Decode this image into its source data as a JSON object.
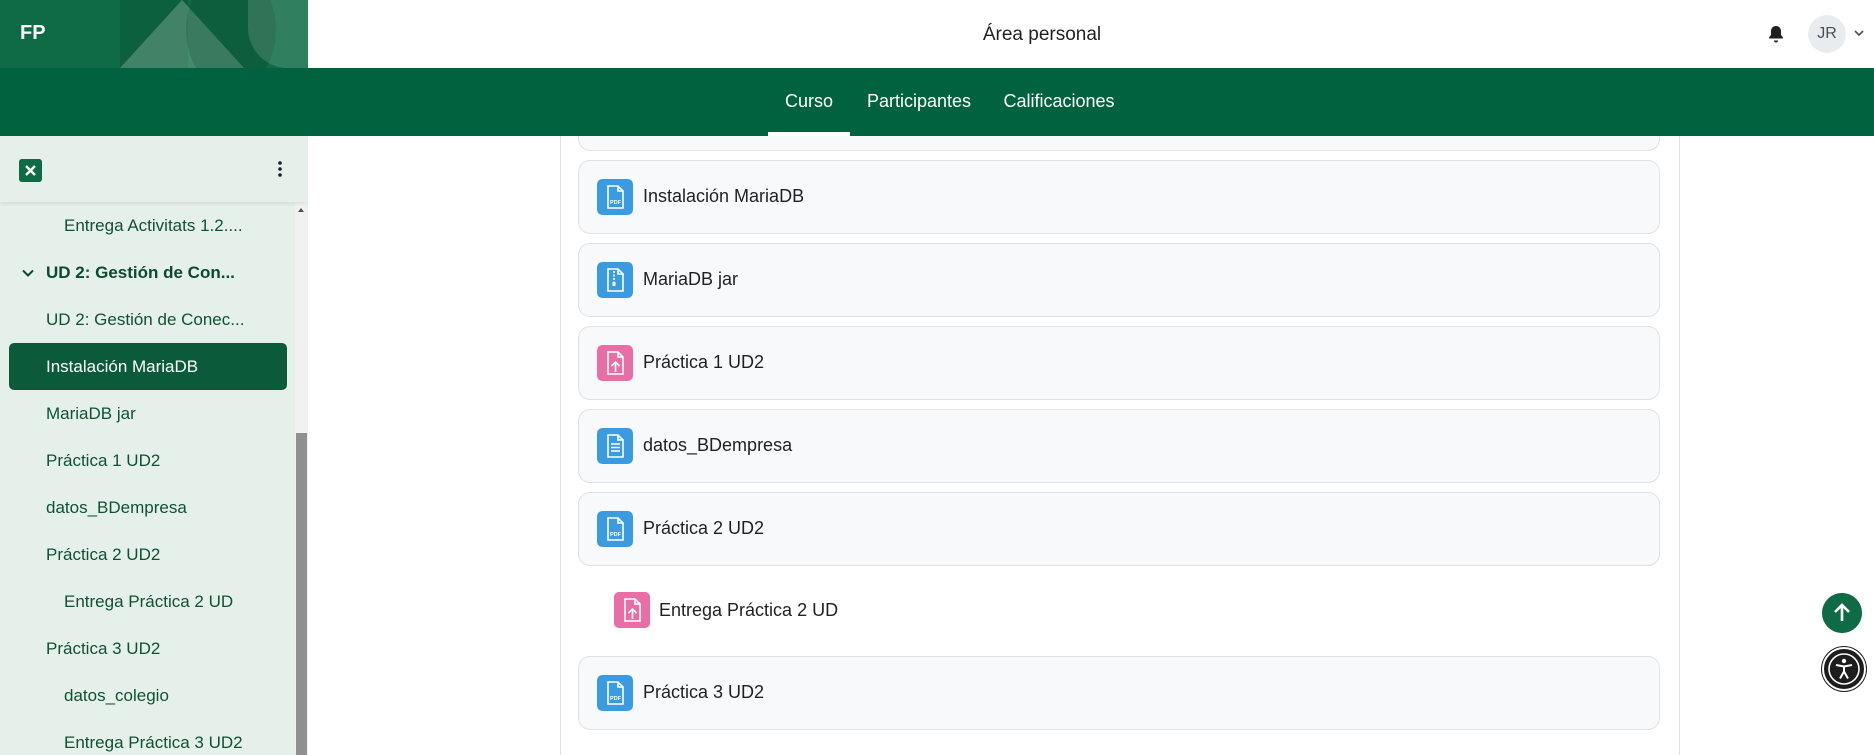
{
  "brand": {
    "text": "FP",
    "color": "#0f6b45"
  },
  "header": {
    "title": "Área personal",
    "bell_icon": "bell-icon",
    "avatar_initials": "JR",
    "avatar_menu_icon": "chevron-down-icon"
  },
  "nav": {
    "tabs": [
      {
        "label": "Curso",
        "active": true
      },
      {
        "label": "Participantes",
        "active": false
      },
      {
        "label": "Calificaciones",
        "active": false
      }
    ],
    "background": "#00623f"
  },
  "sidebar": {
    "close_icon": "close-icon",
    "menu_icon": "kebab-menu-icon",
    "items": [
      {
        "label": "Entrega Activitats 1.2....",
        "level": 2
      },
      {
        "label": "UD 2: Gestión de Con...",
        "level": 0,
        "section": true,
        "expanded": true
      },
      {
        "label": "UD 2: Gestión de Conec...",
        "level": 1
      },
      {
        "label": "Instalación MariaDB",
        "level": 1,
        "active": true
      },
      {
        "label": "MariaDB jar",
        "level": 1
      },
      {
        "label": "Práctica 1 UD2",
        "level": 1
      },
      {
        "label": "datos_BDempresa",
        "level": 1
      },
      {
        "label": "Práctica 2 UD2",
        "level": 1
      },
      {
        "label": "Entrega Práctica 2 UD",
        "level": 2
      },
      {
        "label": "Práctica 3 UD2",
        "level": 1
      },
      {
        "label": "datos_colegio",
        "level": 2
      },
      {
        "label": "Entrega Práctica 3 UD2",
        "level": 2
      }
    ]
  },
  "activities": [
    {
      "label": "Instalación MariaDB",
      "icon": "pdf-icon",
      "color": "#3b9be0"
    },
    {
      "label": "MariaDB jar",
      "icon": "archive-icon",
      "color": "#3b9be0"
    },
    {
      "label": "Práctica 1 UD2",
      "icon": "assignment-upload-icon",
      "color": "#e86fa6"
    },
    {
      "label": "datos_BDempresa",
      "icon": "text-file-icon",
      "color": "#3b9be0"
    },
    {
      "label": "Práctica 2 UD2",
      "icon": "pdf-icon",
      "color": "#3b9be0"
    },
    {
      "label": "Entrega Práctica 2 UD",
      "icon": "assignment-upload-icon",
      "color": "#e86fa6",
      "indented": true
    },
    {
      "label": "Práctica 3 UD2",
      "icon": "pdf-icon",
      "color": "#3b9be0"
    }
  ],
  "floating": {
    "back_to_top_icon": "arrow-up-icon",
    "accessibility_icon": "accessibility-icon"
  }
}
